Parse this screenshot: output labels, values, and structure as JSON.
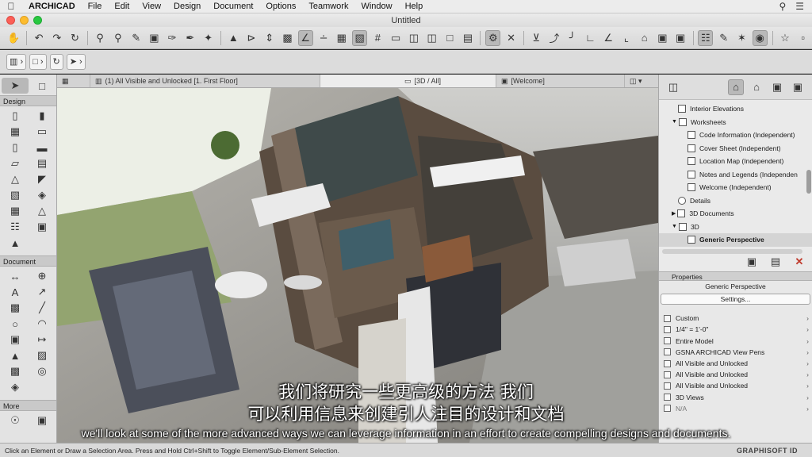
{
  "menubar": {
    "app": "ARCHICAD",
    "items": [
      "File",
      "Edit",
      "View",
      "Design",
      "Document",
      "Options",
      "Teamwork",
      "Window",
      "Help"
    ]
  },
  "window": {
    "title": "Untitled"
  },
  "tabs": [
    {
      "label": "(1) All Visible and Unlocked [1. First Floor]"
    },
    {
      "label": "[3D / All]"
    },
    {
      "label": "[Welcome]"
    }
  ],
  "toolbox": {
    "sections": [
      "Design",
      "Document",
      "More"
    ]
  },
  "navigator": {
    "items": [
      {
        "label": "Interior Elevations",
        "indent": 1
      },
      {
        "label": "Worksheets",
        "indent": 1
      },
      {
        "label": "Code Information (Independent)",
        "indent": 2
      },
      {
        "label": "Cover Sheet (Independent)",
        "indent": 2
      },
      {
        "label": "Location Map (Independent)",
        "indent": 2
      },
      {
        "label": "Notes and Legends (Independen",
        "indent": 2
      },
      {
        "label": "Welcome (Independent)",
        "indent": 2
      },
      {
        "label": "Details",
        "indent": 1
      },
      {
        "label": "3D Documents",
        "indent": 1
      },
      {
        "label": "3D",
        "indent": 1
      },
      {
        "label": "Generic Perspective",
        "indent": 2,
        "selected": true
      }
    ]
  },
  "properties": {
    "header": "Properties",
    "view_name": "Generic Perspective",
    "settings_button": "Settings...",
    "rows": [
      "Custom",
      "1/4\"   =    1'-0\"",
      "Entire Model",
      "GSNA ARCHICAD View Pens",
      "All Visible and Unlocked",
      "All Visible and Unlocked",
      "All Visible and Unlocked",
      "3D Views",
      "N/A"
    ]
  },
  "statusbar": {
    "hint": "Click an Element or Draw a Selection Area. Press and Hold Ctrl+Shift to Toggle Element/Sub-Element Selection.",
    "brand": "GRAPHISOFT ID"
  },
  "subtitles": {
    "zh_line1": "我们将研究一些更高级的方法 我们",
    "zh_line2": "可以利用信息来创建引人注目的设计和文档",
    "en": "we'll look at some of the more advanced ways we can leverage information in an effort to create compelling designs and documents."
  },
  "colors": {
    "window_close": "#fc5f57",
    "window_minimize": "#fdbc2e",
    "window_zoom": "#28c840",
    "selection_blue": "#2d6fd6"
  }
}
